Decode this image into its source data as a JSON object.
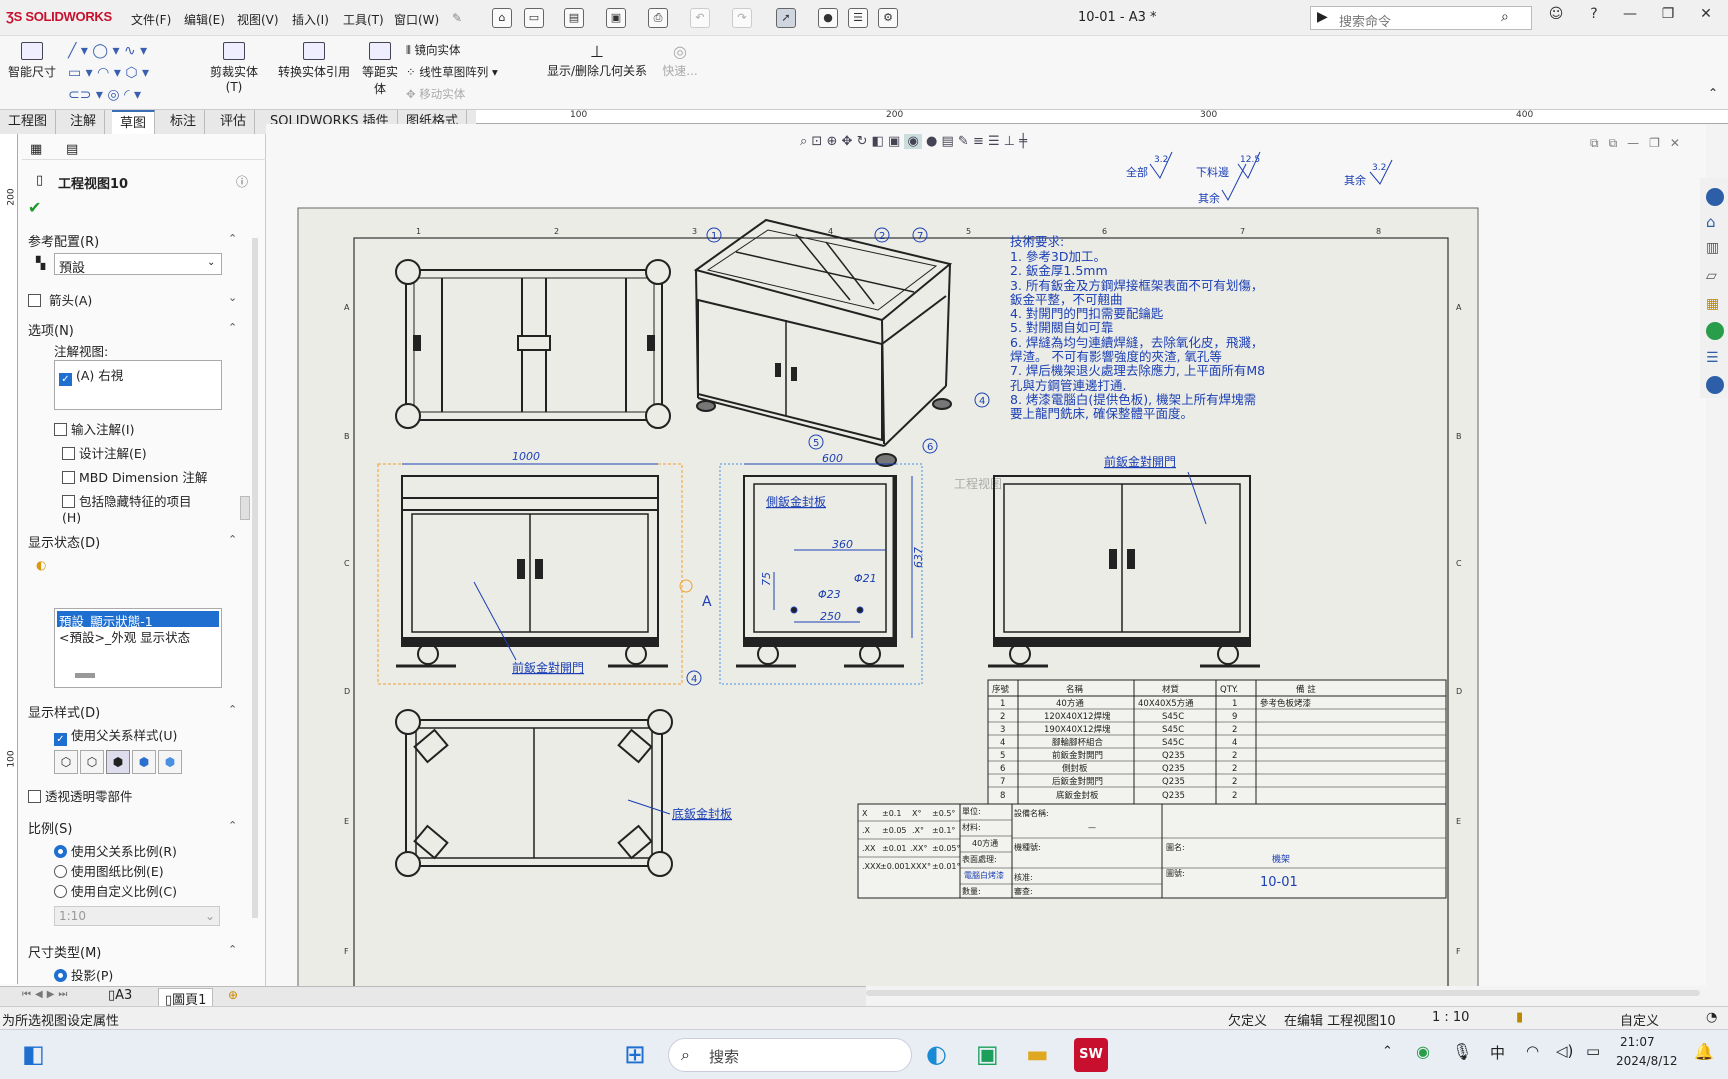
{
  "app": {
    "brand": "SOLIDWORKS",
    "doc_title": "10-01 - A3 *",
    "search_placeholder": "搜索命令"
  },
  "menu": [
    "文件(F)",
    "编辑(E)",
    "视图(V)",
    "插入(I)",
    "工具(T)",
    "窗口(W)"
  ],
  "ribbon": {
    "smart_dim": "智能尺寸",
    "trim": "剪裁实体(T)",
    "convert": "转换实体引用",
    "offset": "等距实体",
    "mirror": "镜向实体",
    "linear_pattern": "线性草图阵列",
    "move": "移动实体",
    "relations": "显示/删除几何关系",
    "quick": "快速..."
  },
  "tabs": [
    "工程图",
    "注解",
    "草图",
    "标注",
    "评估",
    "SOLIDWORKS 插件",
    "图纸格式"
  ],
  "active_tab": "草图",
  "ruler_top": [
    "100",
    "200",
    "300",
    "400"
  ],
  "ruler_left": [
    "200",
    "100"
  ],
  "panel": {
    "title": "工程视图10",
    "ref_config_header": "参考配置(R)",
    "ref_config_value": "預設",
    "arrow_label": "箭头(A)",
    "options_header": "选项(N)",
    "annot_view_label": "注解视图:",
    "annot_view_item": "(A) 右視",
    "import_annot": "输入注解(I)",
    "design_annot": "设计注解(E)",
    "mbd": "MBD Dimension 注解",
    "hidden_feat": "包括隐藏特征的项目(H)",
    "display_state_header": "显示状态(D)",
    "display_state_1": "預設_顯示狀態-1",
    "display_state_2": "<預設>_外观 显示状态",
    "display_style_header": "显示样式(D)",
    "use_parent_style": "使用父关系样式(U)",
    "transparent": "透视透明零部件",
    "scale_header": "比例(S)",
    "scale_parent": "使用父关系比例(R)",
    "scale_sheet": "使用图纸比例(E)",
    "scale_custom": "使用自定义比例(C)",
    "scale_value": "1:10",
    "dim_type_header": "尺寸类型(M)",
    "dim_proj": "投影(P)"
  },
  "sheet_tabs": [
    "A3",
    "圖頁1"
  ],
  "status": {
    "hint": "为所选视图设定属性",
    "undefined": "欠定义",
    "editing": "在编辑 工程视图10",
    "scale": "1 : 10",
    "custom": "自定义"
  },
  "taskbar": {
    "search": "搜索",
    "time": "21:07",
    "date": "2024/8/12",
    "lang": "中"
  },
  "drawing": {
    "notes_title": "技術要求:",
    "notes": [
      "1. 參考3D加工。",
      "2. 鈑金厚1.5mm",
      "3. 所有鈑金及方鋼焊接框架表面不可有划傷，",
      "鈑金平整，不可翹曲",
      "4. 對開門的門扣需要配鑰匙",
      "5. 對開關自如可靠",
      "6. 焊縫為均勻連續焊縫，去除氧化皮，飛濺，",
      "焊渣。  不可有影響強度的夾渣, 氧孔等",
      "7. 焊后機架退火處理去除應力, 上平面所有M8",
      "孔與方鋼管連邊打通.",
      "8. 烤漆電腦白(提供色板), 機架上所有焊塊需",
      "要上龍門銑床, 確保整體平面度。"
    ],
    "labels": {
      "front_door": "前鈑金對開門",
      "side_panel": "側鈑金封板",
      "bottom_panel": "底鈑金封板",
      "view_ghost": "工程视图"
    },
    "dims": {
      "w1000": "1000",
      "w600": "600",
      "w360": "360",
      "w250": "250",
      "h637": "637",
      "h75": "75",
      "d21": "Φ21",
      "d23": "Φ23"
    },
    "roughness": {
      "all": "全部",
      "all_val": "3.2",
      "cut": "下料邊",
      "cut_val": "12.5",
      "rest": "其余",
      "rest_val": "3.2",
      "rest2": "其余"
    },
    "balloons": [
      "1",
      "2",
      "7",
      "4",
      "5",
      "6",
      "4",
      "1"
    ],
    "col_marks": [
      "1",
      "2",
      "3",
      "4",
      "5",
      "6",
      "7",
      "8"
    ],
    "row_marks": [
      "A",
      "B",
      "C",
      "D",
      "E",
      "F"
    ],
    "bom_headers": [
      "序號",
      "名稱",
      "材質",
      "QTY.",
      "備  註"
    ],
    "bom_rows": [
      [
        "1",
        "40方通",
        "40X40X5方通",
        "1",
        "參考色板烤漆"
      ],
      [
        "2",
        "120X40X12焊塊",
        "S45C",
        "9",
        ""
      ],
      [
        "3",
        "190X40X12焊塊",
        "S45C",
        "2",
        ""
      ],
      [
        "4",
        "腳輪腳杯組合",
        "S45C",
        "4",
        ""
      ],
      [
        "5",
        "前鈑金對開門",
        "Q235",
        "2",
        ""
      ],
      [
        "6",
        "側封板",
        "Q235",
        "2",
        ""
      ],
      [
        "7",
        "后鈑金對開門",
        "Q235",
        "2",
        ""
      ],
      [
        "8",
        "底鈑金封板",
        "Q235",
        "2",
        ""
      ]
    ],
    "tb": {
      "tol": [
        [
          "X",
          "±0.1",
          "X°",
          "±0.5°"
        ],
        [
          ".X",
          "±0.05",
          ".X°",
          "±0.1°"
        ],
        [
          ".XX",
          "±0.01",
          ".XX°",
          "±0.05°"
        ],
        [
          ".XXX",
          "±0.001",
          ".XXX°",
          "±0.01°"
        ]
      ],
      "unit": "單位:",
      "material": "材料:",
      "material_val": "40方通",
      "finish": "表面處理:",
      "finish_val": "電腦白烤漆",
      "qty": "數量:",
      "equip": "設備名稱:",
      "dash": "—",
      "proj": "機種號:",
      "check": "核准:",
      "review": "審查:",
      "dwg_name": "圖名:",
      "dwg_name_val": "機架",
      "dwg_no": "圖號:",
      "dwg_no_val": "10-01"
    }
  },
  "colors": {
    "accent": "#1f6fd0",
    "annot": "#1b3fb5",
    "sheet": "#e8e8e2",
    "selection": "#f0a030"
  }
}
